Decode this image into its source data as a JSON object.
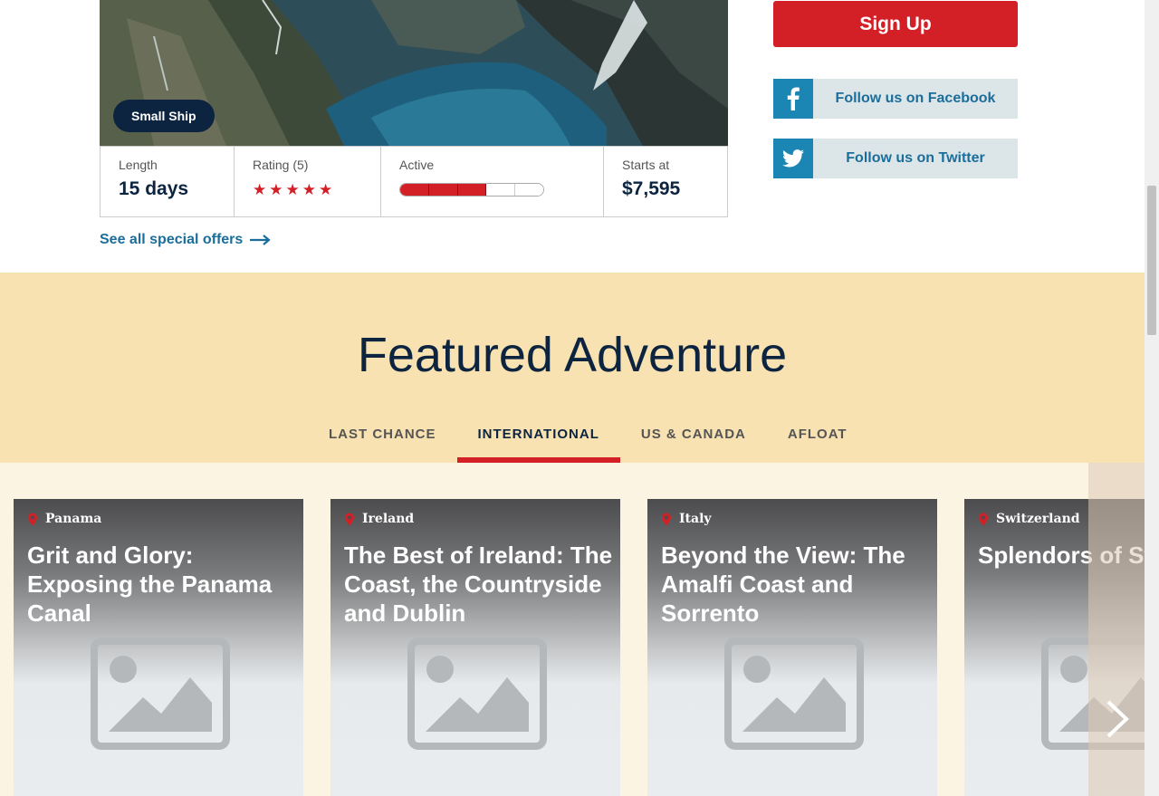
{
  "trip": {
    "badge": "Small Ship",
    "length_label": "Length",
    "length_value": "15 days",
    "rating_label": "Rating (5)",
    "rating_stars": 5,
    "active_label": "Active",
    "active_level": 3,
    "active_max": 5,
    "price_label": "Starts at",
    "price_value": "$7,595"
  },
  "offers_link": "See all special offers",
  "sidebar": {
    "signup_label": "Sign Up",
    "facebook_label": "Follow us on Facebook",
    "twitter_label": "Follow us on Twitter"
  },
  "featured": {
    "heading": "Featured Adventure",
    "tabs": [
      {
        "label": "LAST CHANCE"
      },
      {
        "label": "INTERNATIONAL"
      },
      {
        "label": "US & CANADA"
      },
      {
        "label": "AFLOAT"
      }
    ],
    "active_tab": "INTERNATIONAL",
    "cards": [
      {
        "location": "Panama",
        "title": "Grit and Glory: Exposing the Panama Canal"
      },
      {
        "location": "Ireland",
        "title": "The Best of Ireland: The Coast, the Countryside and Dublin"
      },
      {
        "location": "Italy",
        "title": "Beyond the View: The Amalfi Coast and Sorrento"
      },
      {
        "location": "Switzerland",
        "title": "Splendors of Switzerland By R"
      }
    ]
  },
  "colors": {
    "brand_red": "#d32027",
    "navy": "#0d2440",
    "link_blue": "#1b6e9c",
    "social_blue": "#1b86b3",
    "featured_bg": "#f8e2b1"
  },
  "icons": {
    "facebook": "facebook-icon",
    "twitter": "twitter-icon",
    "location": "map-pin-icon",
    "placeholder": "image-placeholder-icon",
    "next": "chevron-right-icon",
    "arrow": "arrow-right-icon"
  }
}
